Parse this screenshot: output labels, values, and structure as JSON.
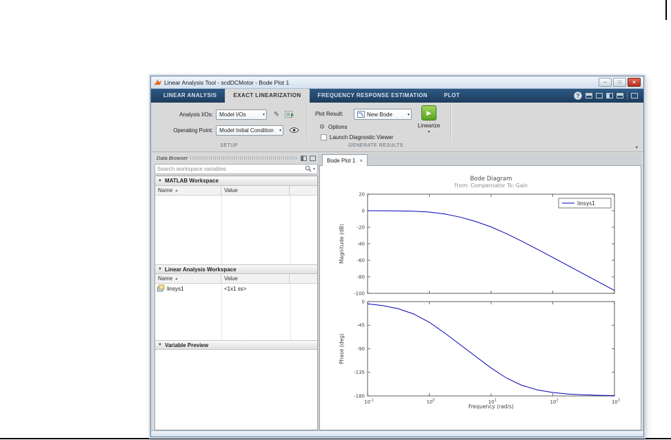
{
  "window": {
    "title": "Linear Analysis Tool - scdDCMotor - Bode Plot 1"
  },
  "icons": {
    "minimize": "–",
    "maximize": "□",
    "close": "×",
    "help": "?",
    "caret_down": "▾",
    "triangle_down": "▼",
    "sort_asc": "▲",
    "collapse": "▴",
    "play": "▶",
    "gear": "⚙",
    "pencil": "✎",
    "tab_close": "×"
  },
  "ribbon": {
    "tabs": [
      {
        "label": "LINEAR ANALYSIS",
        "active": false
      },
      {
        "label": "EXACT LINEARIZATION",
        "active": true
      },
      {
        "label": "FREQUENCY RESPONSE ESTIMATION",
        "active": false
      },
      {
        "label": "PLOT",
        "active": false
      }
    ],
    "setup": {
      "analysis_ios_label": "Analysis I/Os:",
      "analysis_ios_value": "Model I/Os",
      "operating_point_label": "Operating Point:",
      "operating_point_value": "Model Initial Condition",
      "section_label": "SETUP"
    },
    "generate": {
      "plot_result_label": "Plot Result:",
      "plot_result_value": "New Bode",
      "options_label": "Options",
      "diagnostic_label": "Launch Diagnostic Viewer",
      "linearize_label": "Linearize",
      "section_label": "GENERATE RESULTS"
    }
  },
  "data_browser": {
    "title": "Data Browser",
    "search_placeholder": "Search workspace variables",
    "sections": {
      "matlab_workspace": {
        "label": "MATLAB Workspace",
        "columns": [
          "Name",
          "Value"
        ],
        "rows": []
      },
      "linear_analysis_workspace": {
        "label": "Linear Analysis Workspace",
        "columns": [
          "Name",
          "Value"
        ],
        "rows": [
          {
            "name": "linsys1",
            "value": "<1x1 ss>"
          }
        ]
      },
      "variable_preview": {
        "label": "Variable Preview"
      }
    }
  },
  "document": {
    "tab_label": "Bode Plot 1"
  },
  "chart_data": {
    "type": "line",
    "title": "Bode Diagram",
    "subtitle": "From: Compensator  To: Gain",
    "xlabel": "Frequency  (rad/s)",
    "x_scale": "log",
    "xlim": [
      0.1,
      1000
    ],
    "x_tick_exponents": [
      -1,
      0,
      1,
      2,
      3
    ],
    "grid": false,
    "series_color": "#0000b4",
    "legend": {
      "entries": [
        "linsys1"
      ],
      "position": "top-right"
    },
    "subplots": [
      {
        "name": "magnitude",
        "ylabel": "Magnitude (dB)",
        "ylim": [
          -100,
          20
        ],
        "y_ticks": [
          20,
          0,
          -20,
          -40,
          -60,
          -80,
          -100
        ],
        "x": [
          0.1,
          0.178,
          0.316,
          0.562,
          1,
          1.78,
          3.16,
          5.62,
          10,
          17.8,
          31.6,
          56.2,
          100,
          178,
          316,
          562,
          1000
        ],
        "y": [
          -0.02,
          -0.06,
          -0.19,
          -0.58,
          -1.64,
          -3.95,
          -7.77,
          -12.96,
          -19.59,
          -27.72,
          -36.89,
          -46.61,
          -56.52,
          -66.51,
          -76.47,
          -86.47,
          -96.48
        ]
      },
      {
        "name": "phase",
        "ylabel": "Phase (deg)",
        "ylim": [
          -180,
          0
        ],
        "y_ticks": [
          0,
          -45,
          -90,
          -135,
          -180
        ],
        "x": [
          0.1,
          0.178,
          0.316,
          0.562,
          1,
          1.78,
          3.16,
          5.62,
          10,
          17.8,
          31.6,
          56.2,
          100,
          178,
          316,
          562,
          1000
        ],
        "y": [
          -4.39,
          -7.79,
          -13.71,
          -23.76,
          -39.4,
          -59.97,
          -82.14,
          -104.39,
          -126.47,
          -145.84,
          -159.72,
          -168.38,
          -173.43,
          -176.3,
          -177.92,
          -178.83,
          -179.34
        ]
      }
    ]
  }
}
